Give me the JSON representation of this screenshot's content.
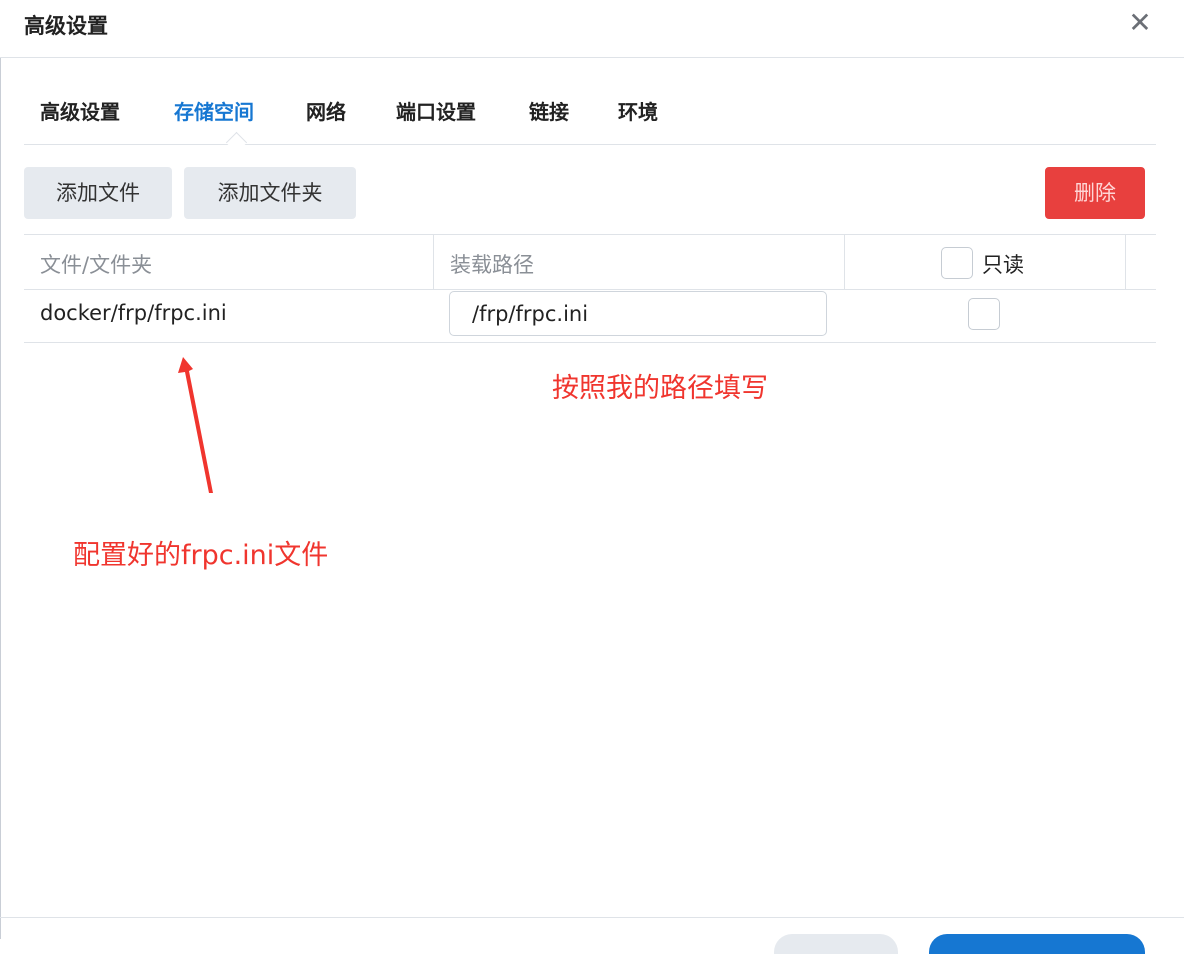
{
  "dialog": {
    "title": "高级设置",
    "close_icon": "close-icon"
  },
  "tabs": [
    {
      "label": "高级设置",
      "active": false
    },
    {
      "label": "存储空间",
      "active": true
    },
    {
      "label": "网络",
      "active": false
    },
    {
      "label": "端口设置",
      "active": false
    },
    {
      "label": "链接",
      "active": false
    },
    {
      "label": "环境",
      "active": false
    }
  ],
  "toolbar": {
    "add_file": "添加文件",
    "add_folder": "添加文件夹",
    "delete": "删除"
  },
  "table": {
    "headers": {
      "file": "文件/文件夹",
      "mount": "装载路径",
      "readonly": "只读"
    },
    "rows": [
      {
        "file": "docker/frp/frpc.ini",
        "mount_path": "/frp/frpc.ini",
        "readonly": false
      }
    ]
  },
  "annotations": {
    "mount_note": "按照我的路径填写",
    "file_note": "配置好的frpc.ini文件"
  },
  "colors": {
    "accent": "#1677d2",
    "danger": "#e8403e",
    "annotation": "#f0352e"
  }
}
